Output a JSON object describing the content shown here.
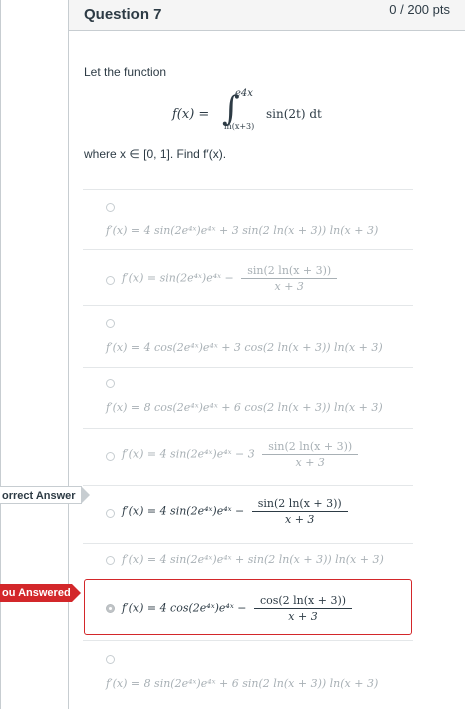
{
  "question": {
    "title": "Question 7",
    "points": "0 / 200 pts",
    "intro": "Let the function",
    "integral": {
      "lhs": "f(x) =",
      "upper": "e4x",
      "lower": "ln(x+3)",
      "integrand": "sin(2t) dt"
    },
    "domain_text": "where x ∈ [0, 1]. Find f′(x)."
  },
  "options": [
    {
      "main": "f′(x) = 4 sin(2e⁴ˣ)e⁴ˣ + 3 sin(2 ln(x + 3)) ln(x + 3)",
      "num": "",
      "den": ""
    },
    {
      "main": "f′(x) = sin(2e⁴ˣ)e⁴ˣ −",
      "num": "sin(2 ln(x + 3))",
      "den": "x + 3"
    },
    {
      "main": "f′(x) = 4 cos(2e⁴ˣ)e⁴ˣ + 3 cos(2 ln(x + 3)) ln(x + 3)",
      "num": "",
      "den": ""
    },
    {
      "main": "f′(x) = 8 cos(2e⁴ˣ)e⁴ˣ + 6 cos(2 ln(x + 3)) ln(x + 3)",
      "num": "",
      "den": ""
    },
    {
      "main": "f′(x) = 4 sin(2e⁴ˣ)e⁴ˣ − 3",
      "num": "sin(2 ln(x + 3))",
      "den": "x + 3"
    },
    {
      "main": "f′(x) = 4 sin(2e⁴ˣ)e⁴ˣ −",
      "num": "sin(2 ln(x + 3))",
      "den": "x + 3"
    },
    {
      "main": "f′(x) = 4 sin(2e⁴ˣ)e⁴ˣ + sin(2 ln(x + 3)) ln(x + 3)",
      "num": "",
      "den": ""
    },
    {
      "main": "f′(x) = 4 cos(2e⁴ˣ)e⁴ˣ −",
      "num": "cos(2 ln(x + 3))",
      "den": "x + 3"
    },
    {
      "main": "f′(x) = 8 sin(2e⁴ˣ)e⁴ˣ + 6 sin(2 ln(x + 3)) ln(x + 3)",
      "num": "",
      "den": ""
    }
  ],
  "tags": {
    "correct_label": "orrect Answer",
    "you_label": "ou Answered"
  },
  "colors": {
    "incorrect": "#d3272a",
    "faint_text": "#a8b0b5",
    "text": "#2d3b45"
  }
}
